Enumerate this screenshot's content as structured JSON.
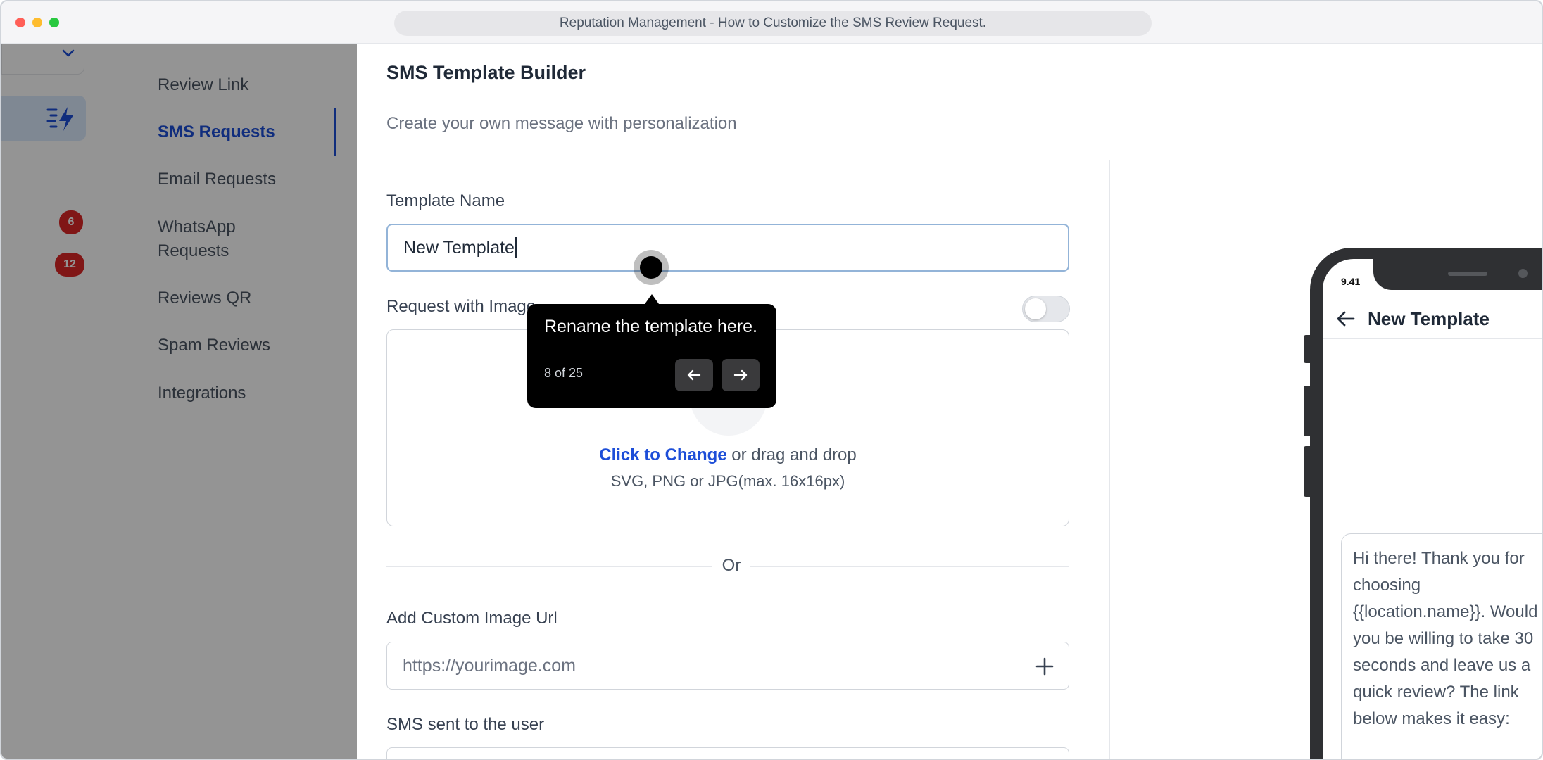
{
  "window": {
    "title": "Reputation Management - How to Customize the SMS Review Request."
  },
  "sidebar": {
    "badges": [
      "6",
      "12"
    ],
    "items": [
      {
        "label": "Review Link"
      },
      {
        "label": "SMS Requests",
        "active": true
      },
      {
        "label": "Email Requests"
      },
      {
        "label": "WhatsApp Requests"
      },
      {
        "label": "Reviews QR"
      },
      {
        "label": "Spam Reviews"
      },
      {
        "label": "Integrations"
      }
    ]
  },
  "main": {
    "title": "SMS Template Builder",
    "subtitle": "Create your own message with personalization",
    "template_name_label": "Template Name",
    "template_name_value": "New Template",
    "request_with_image_label": "Request with Image",
    "upload": {
      "link_text": "Click to Change",
      "rest_text": " or drag and drop",
      "formats": "SVG, PNG or JPG(max. 16x16px)"
    },
    "or_text": "Or",
    "custom_image_label": "Add Custom Image Url",
    "custom_image_placeholder": "https://yourimage.com",
    "sms_label": "SMS sent to the user"
  },
  "preview": {
    "time": "9.41",
    "title": "New Template",
    "message": "Hi there! Thank you for choosing {{location.name}}. Would you be willing to take 30 seconds and leave us a quick review? The link below makes it easy:"
  },
  "tooltip": {
    "text": "Rename the template here.",
    "step": "8 of 25"
  },
  "colors": {
    "accent": "#1d4ed8",
    "badge": "#dc2626",
    "tooltip_bg": "#000000"
  }
}
